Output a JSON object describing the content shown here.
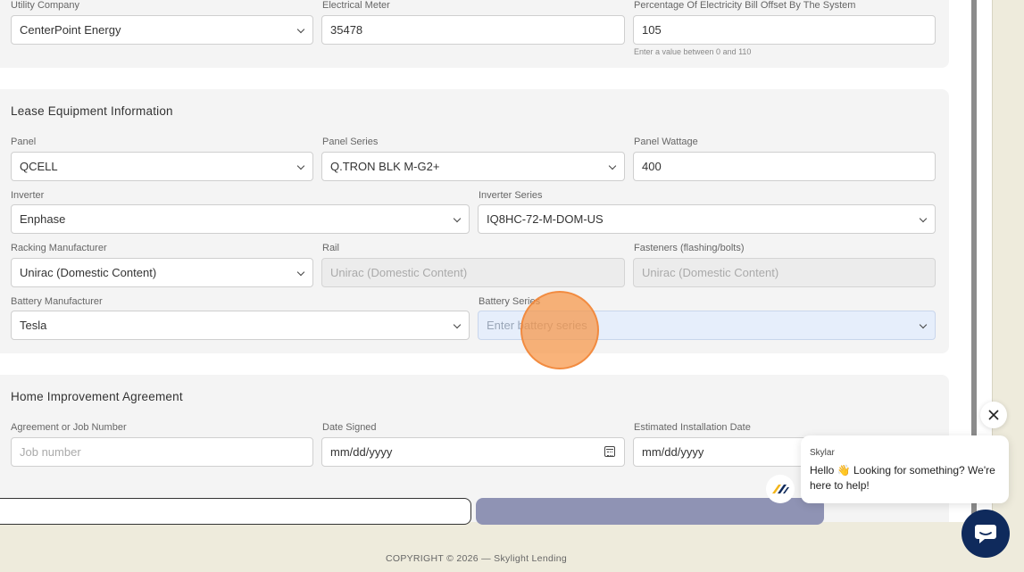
{
  "utility": {
    "utility_company_label": "Utility Company",
    "utility_company_value": "CenterPoint Energy",
    "electrical_meter_label": "Electrical Meter",
    "electrical_meter_value": "35478",
    "offset_label": "Percentage Of Electricity Bill Offset By The System",
    "offset_value": "105",
    "offset_hint": "Enter a value between 0 and 110"
  },
  "lease": {
    "title": "Lease Equipment Information",
    "panel_label": "Panel",
    "panel_value": "QCELL",
    "panel_series_label": "Panel Series",
    "panel_series_value": "Q.TRON BLK M-G2+",
    "panel_wattage_label": "Panel Wattage",
    "panel_wattage_value": "400",
    "inverter_label": "Inverter",
    "inverter_value": "Enphase",
    "inverter_series_label": "Inverter Series",
    "inverter_series_value": "IQ8HC-72-M-DOM-US",
    "racking_label": "Racking Manufacturer",
    "racking_value": "Unirac (Domestic Content)",
    "rail_label": "Rail",
    "rail_value": "Unirac (Domestic Content)",
    "fasteners_label": "Fasteners (flashing/bolts)",
    "fasteners_value": "Unirac (Domestic Content)",
    "battery_mfr_label": "Battery Manufacturer",
    "battery_mfr_value": "Tesla",
    "battery_series_label": "Battery Series",
    "battery_series_placeholder": "Enter battery series"
  },
  "agreement": {
    "title": "Home Improvement Agreement",
    "job_label": "Agreement or Job Number",
    "job_placeholder": "Job number",
    "date_signed_label": "Date Signed",
    "date_signed_value": "mm/dd/yyyy",
    "install_date_label": "Estimated Installation Date",
    "install_date_value": "mm/dd/yyyy"
  },
  "footer": {
    "copyright": "COPYRIGHT © 2026 — Skylight Lending"
  },
  "chat": {
    "name": "Skylar",
    "message": "Hello 👋 Looking for something? We're here to help!"
  },
  "colors": {
    "page_bg": "#eeebdc",
    "card_bg": "#f4f4f4",
    "primary_button": "#8f93b4",
    "chat_launcher": "#0f2a5c",
    "cursor_highlight": "#f79646"
  }
}
